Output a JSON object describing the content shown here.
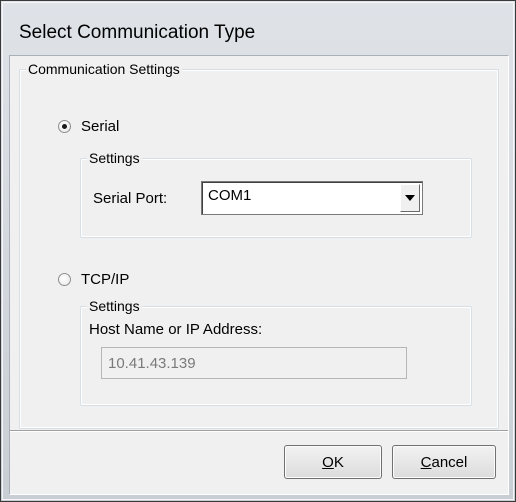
{
  "window": {
    "title": "Select Communication Type"
  },
  "communication_settings": {
    "label": "Communication Settings",
    "serial": {
      "label": "Serial",
      "selected": true,
      "settings_label": "Settings",
      "port_label": "Serial Port:",
      "port_value": "COM1"
    },
    "tcpip": {
      "label": "TCP/IP",
      "selected": false,
      "settings_label": "Settings",
      "host_label": "Host Name or IP Address:",
      "host_value": "10.41.43.139"
    }
  },
  "buttons": {
    "ok": {
      "mnemonic": "O",
      "rest": "K"
    },
    "cancel": {
      "mnemonic": "C",
      "rest": "ancel"
    }
  },
  "icons": {
    "dropdown": "chevron-down-icon",
    "radio_checked": "radio-checked-icon",
    "radio_unchecked": "radio-unchecked-icon"
  }
}
